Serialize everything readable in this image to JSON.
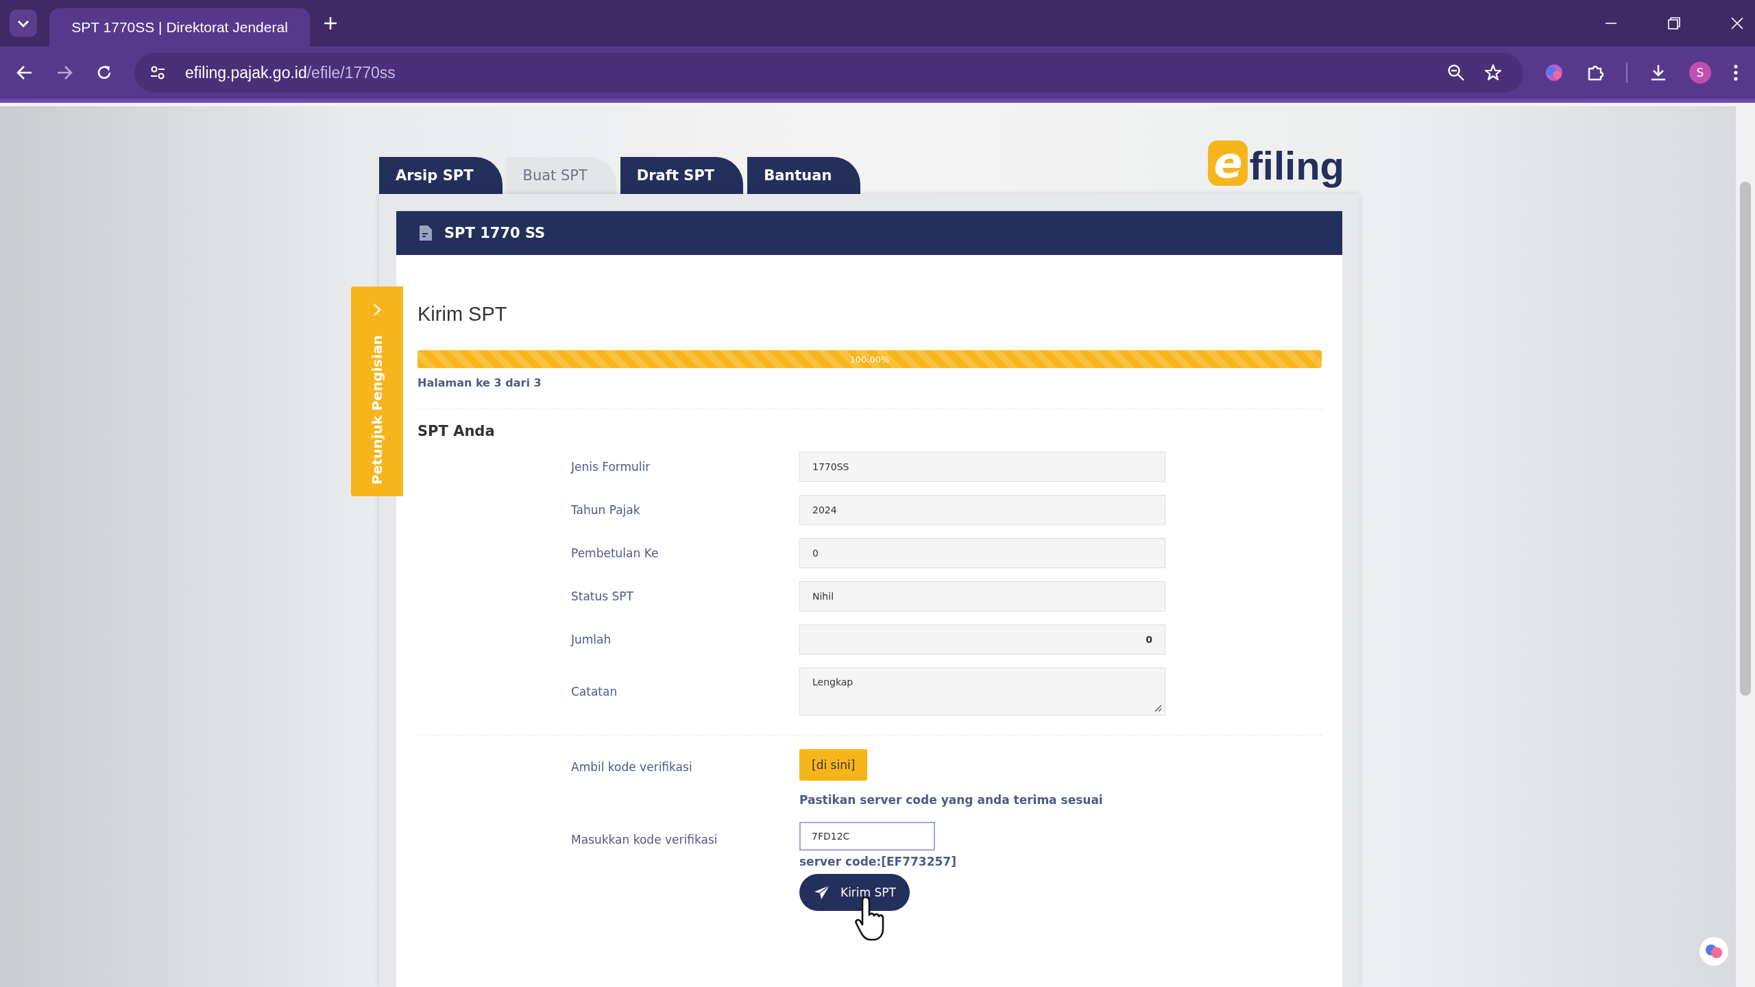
{
  "browser": {
    "tab_title": "SPT 1770SS | Direktorat Jenderal",
    "address_host": "efiling.pajak.go.id",
    "address_path": "/efile/1770ss",
    "profile_initial": "S"
  },
  "tabs": [
    {
      "label": "Arsip SPT",
      "selected": false
    },
    {
      "label": "Buat SPT",
      "selected": true
    },
    {
      "label": "Draft SPT",
      "selected": false
    },
    {
      "label": "Bantuan",
      "selected": false
    }
  ],
  "logo": {
    "mark": "e",
    "text": "filing"
  },
  "side_tab": {
    "label": "Petunjuk Pengisian"
  },
  "panel": {
    "title": "SPT 1770 SS",
    "heading": "Kirim SPT",
    "progress": {
      "level": 1,
      "label": "100.00%"
    },
    "page_info": "Halaman ke 3 dari 3",
    "section_title": "SPT Anda",
    "fields": [
      {
        "label": "Jenis Formulir",
        "value": "1770SS",
        "kind": "text"
      },
      {
        "label": "Tahun Pajak",
        "value": "2024",
        "kind": "text"
      },
      {
        "label": "Pembetulan Ke",
        "value": "0",
        "kind": "text"
      },
      {
        "label": "Status SPT",
        "value": "Nihil",
        "kind": "text"
      },
      {
        "label": "Jumlah",
        "value": "0",
        "kind": "number"
      },
      {
        "label": "Catatan",
        "value": "Lengkap",
        "kind": "textarea"
      }
    ],
    "verification": {
      "label": "Ambil kode verifikasi",
      "button": "[di sini]",
      "note": "Pastikan server code yang anda terima sesuai",
      "input_label": "Masukkan kode verifikasi",
      "input_value": "7FD12C",
      "server_code": "server code:[EF773257]"
    },
    "submit": "Kirim SPT"
  }
}
